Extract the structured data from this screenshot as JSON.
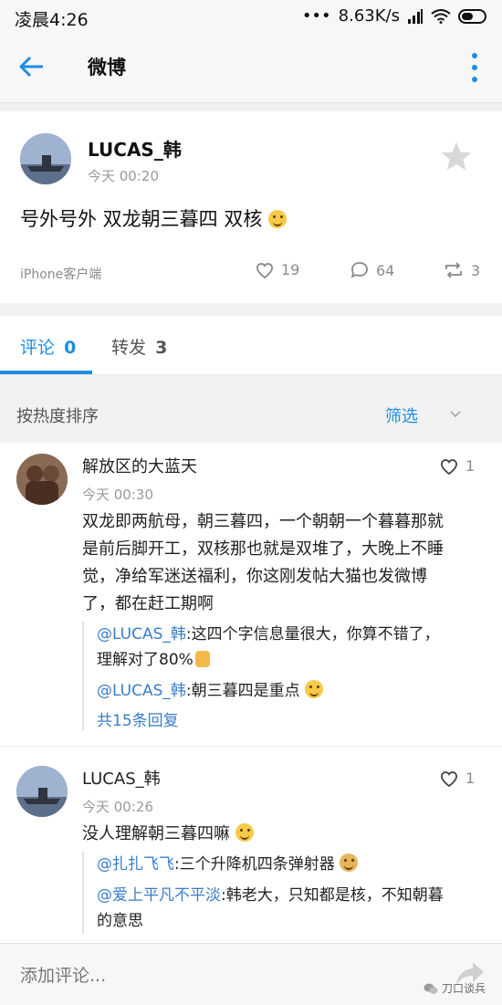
{
  "status_bar": {
    "time": "凌晨4:26",
    "speed": "8.63K/s"
  },
  "header": {
    "title": "微博"
  },
  "post": {
    "author": "LUCAS_韩",
    "time": "今天 00:20",
    "text": "号外号外 双龙朝三暮四 双核",
    "source": "iPhone客户端",
    "likes": "19",
    "comments": "64",
    "reposts": "3"
  },
  "tabs": [
    {
      "label": "评论",
      "count": "0"
    },
    {
      "label": "转发",
      "count": "3"
    }
  ],
  "sort": {
    "label": "按热度排序",
    "filter": "筛选"
  },
  "comments": [
    {
      "author": "解放区的大蓝天",
      "time": "今天 00:30",
      "likes": "1",
      "text_lines": [
        "双龙即两航母，朝三暮四，一个朝朝一个暮暮那就",
        "是前后脚开工，双核那也就是双堆了，大晚上不睡",
        "觉，净给军迷送福利，你这刚发帖大猫也发微博",
        "了，都在赶工期啊"
      ],
      "replies": [
        {
          "user": "@LUCAS_韩",
          "text_lines": [
            ":这四个字信息量很大，你算不错了，",
            "理解对了80%"
          ]
        },
        {
          "user": "@LUCAS_韩",
          "text_lines": [
            ":朝三暮四是重点"
          ]
        }
      ],
      "more": "共15条回复"
    },
    {
      "author": "LUCAS_韩",
      "time": "今天 00:26",
      "likes": "1",
      "text_lines": [
        "没人理解朝三暮四嘛"
      ],
      "replies": [
        {
          "user": "@扎扎飞飞",
          "text_lines": [
            ":三个升降机四条弹射器"
          ]
        },
        {
          "user": "@爱上平凡不平淡",
          "text_lines": [
            ":韩老大，只知都是核，不知朝暮",
            "的意思"
          ]
        }
      ]
    }
  ],
  "bottom": {
    "placeholder": "添加评论...",
    "watermark": "刀口谈兵"
  },
  "colors": {
    "accent": "#1f8ce1",
    "link": "#3a7dc9"
  }
}
